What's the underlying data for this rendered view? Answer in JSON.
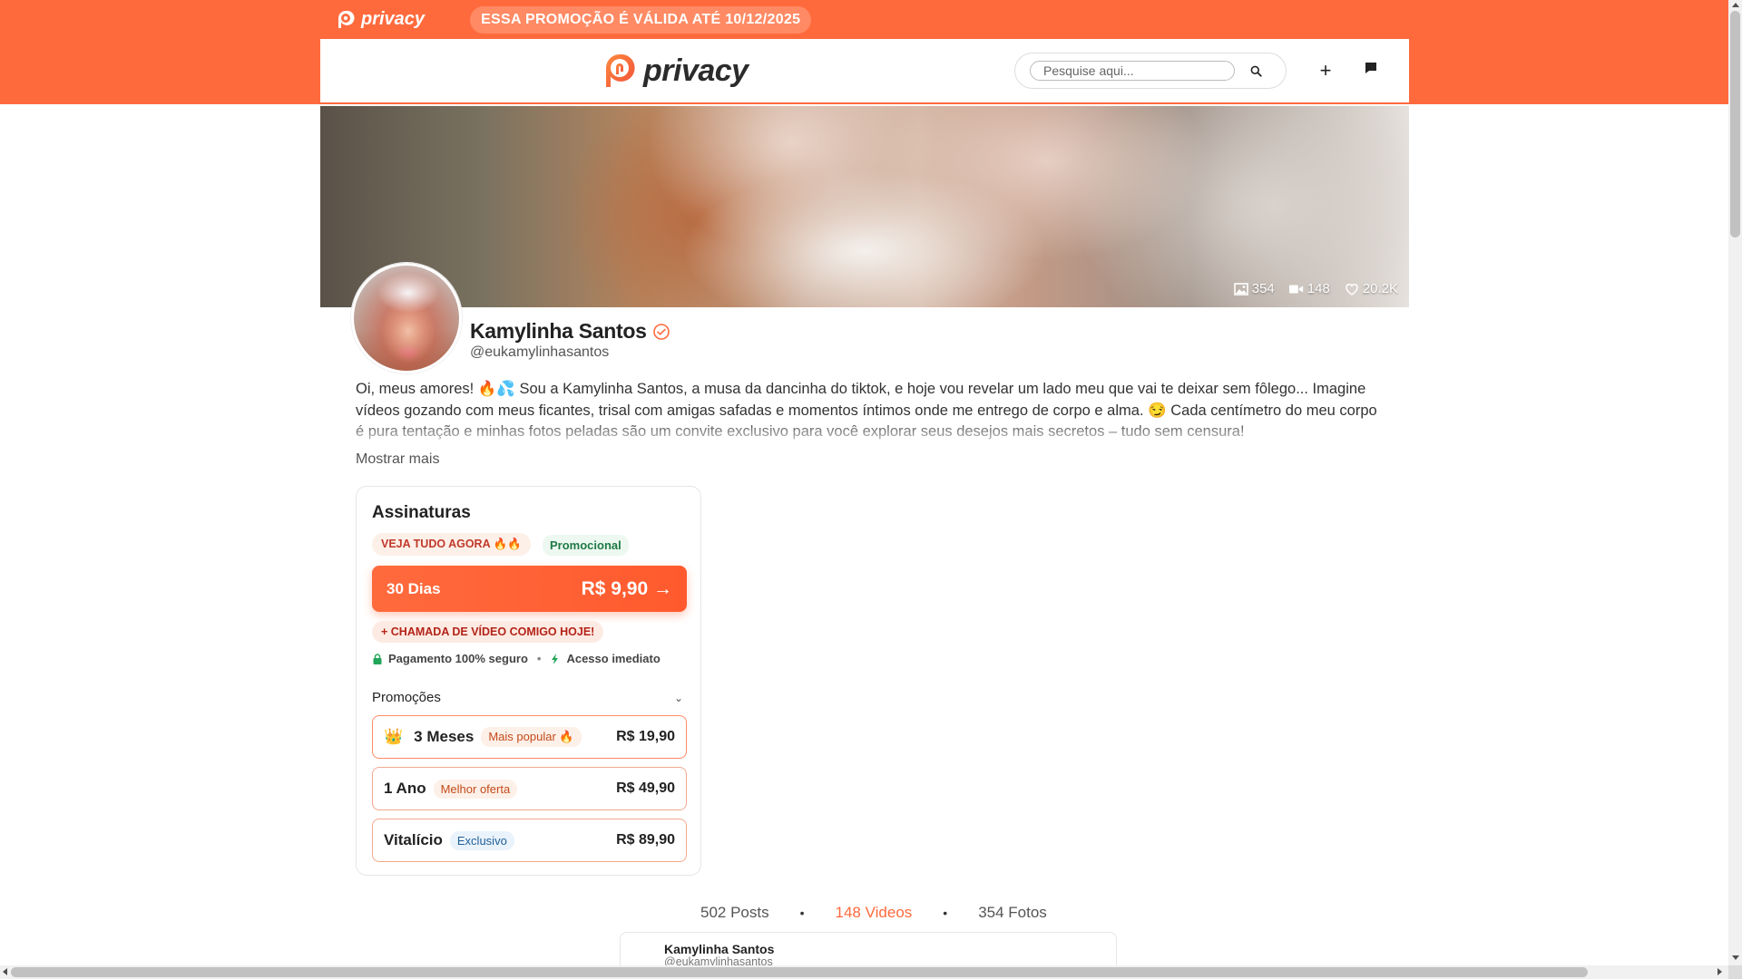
{
  "header": {
    "mini_logo_text": "privacy",
    "promo_banner": "ESSA PROMOÇÃO É VÁLIDA ATÉ 10/12/2025",
    "main_logo_text": "privacy",
    "search_placeholder": "Pesquise aqui...",
    "plus_label": "+"
  },
  "profile": {
    "stats": {
      "photos": "354",
      "videos": "148",
      "likes": "20.2K"
    },
    "name": "Kamylinha Santos",
    "handle": "@eukamylinhasantos",
    "bio": "Oi, meus amores! 🔥💦 Sou a Kamylinha Santos, a musa da dancinha do tiktok, e hoje vou revelar um lado meu que vai te deixar sem fôlego... Imagine vídeos gozando com meus ficantes, trisal com amigas safadas e momentos íntimos onde me entrego de corpo e alma. 😏 Cada centímetro do meu corpo é pura tentação e minhas fotos peladas são um convite exclusivo para você explorar seus desejos mais secretos – tudo sem censura!",
    "show_more": "Mostrar mais"
  },
  "subscriptions": {
    "title": "Assinaturas",
    "hot_badge": "VEJA TUDO AGORA 🔥🔥",
    "promo_badge": "Promocional",
    "main_plan": {
      "duration": "30 Dias",
      "price": "R$ 9,90 →"
    },
    "video_call_badge": "+ CHAMADA DE VÍDEO COMIGO HOJE!",
    "secure_payment": "Pagamento 100% seguro",
    "instant_access": "Acesso imediato",
    "promotions_label": "Promoções",
    "options": [
      {
        "icon": "crown-icon",
        "name": "3 Meses",
        "tag": "Mais popular 🔥",
        "price": "R$ 19,90"
      },
      {
        "name": "1 Ano",
        "tag": "Melhor oferta",
        "price": "R$ 49,90"
      },
      {
        "name": "Vitalício",
        "tag": "Exclusivo",
        "price": "R$ 89,90"
      }
    ]
  },
  "tabs": [
    {
      "label": "502 Posts"
    },
    {
      "label": "148 Videos"
    },
    {
      "label": "354 Fotos"
    }
  ],
  "post": {
    "author_name": "Kamylinha Santos",
    "author_handle": "@eukamylinhasantos"
  },
  "colors": {
    "accent": "#ff6a3d",
    "promo_green": "#1f7a45",
    "secure_green": "#22a559"
  }
}
